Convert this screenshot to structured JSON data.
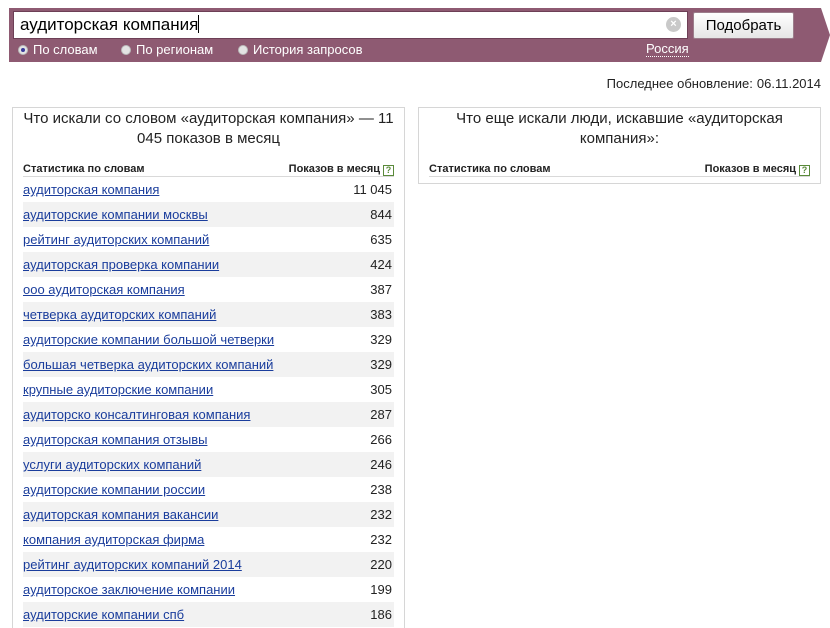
{
  "search": {
    "query": "аудиторская компания",
    "clear_symbol": "×",
    "submit_label": "Подобрать",
    "modes": [
      {
        "label": "По словам",
        "selected": true
      },
      {
        "label": "По регионам",
        "selected": false
      },
      {
        "label": "История запросов",
        "selected": false
      }
    ],
    "region": "Россия"
  },
  "updated": {
    "label": "Последнее обновление:",
    "date": "06.11.2014"
  },
  "left_panel": {
    "title": "Что искали со словом «аудиторская компания» — 11 045 показов в месяц",
    "col_words": "Статистика по словам",
    "col_count": "Показов в месяц",
    "help": "?",
    "rows": [
      {
        "phrase": "аудиторская компания",
        "count": "11 045"
      },
      {
        "phrase": "аудиторские компании москвы",
        "count": "844"
      },
      {
        "phrase": "рейтинг аудиторских компаний",
        "count": "635"
      },
      {
        "phrase": "аудиторская проверка компании",
        "count": "424"
      },
      {
        "phrase": "ооо аудиторская компания",
        "count": "387"
      },
      {
        "phrase": "четверка аудиторских компаний",
        "count": "383"
      },
      {
        "phrase": "аудиторские компании большой четверки",
        "count": "329"
      },
      {
        "phrase": "большая четверка аудиторских компаний",
        "count": "329"
      },
      {
        "phrase": "крупные аудиторские компании",
        "count": "305"
      },
      {
        "phrase": "аудиторско консалтинговая компания",
        "count": "287"
      },
      {
        "phrase": "аудиторская компания отзывы",
        "count": "266"
      },
      {
        "phrase": "услуги аудиторских компаний",
        "count": "246"
      },
      {
        "phrase": "аудиторские компании россии",
        "count": "238"
      },
      {
        "phrase": "аудиторская компания вакансии",
        "count": "232"
      },
      {
        "phrase": "компания аудиторская фирма",
        "count": "232"
      },
      {
        "phrase": "рейтинг аудиторских компаний 2014",
        "count": "220"
      },
      {
        "phrase": "аудиторское заключение компании",
        "count": "199"
      },
      {
        "phrase": "аудиторские компании спб",
        "count": "186"
      }
    ]
  },
  "right_panel": {
    "title": "Что еще искали люди, искавшие «аудиторская компания»:",
    "col_words": "Статистика по словам",
    "col_count": "Показов в месяц",
    "help": "?"
  }
}
